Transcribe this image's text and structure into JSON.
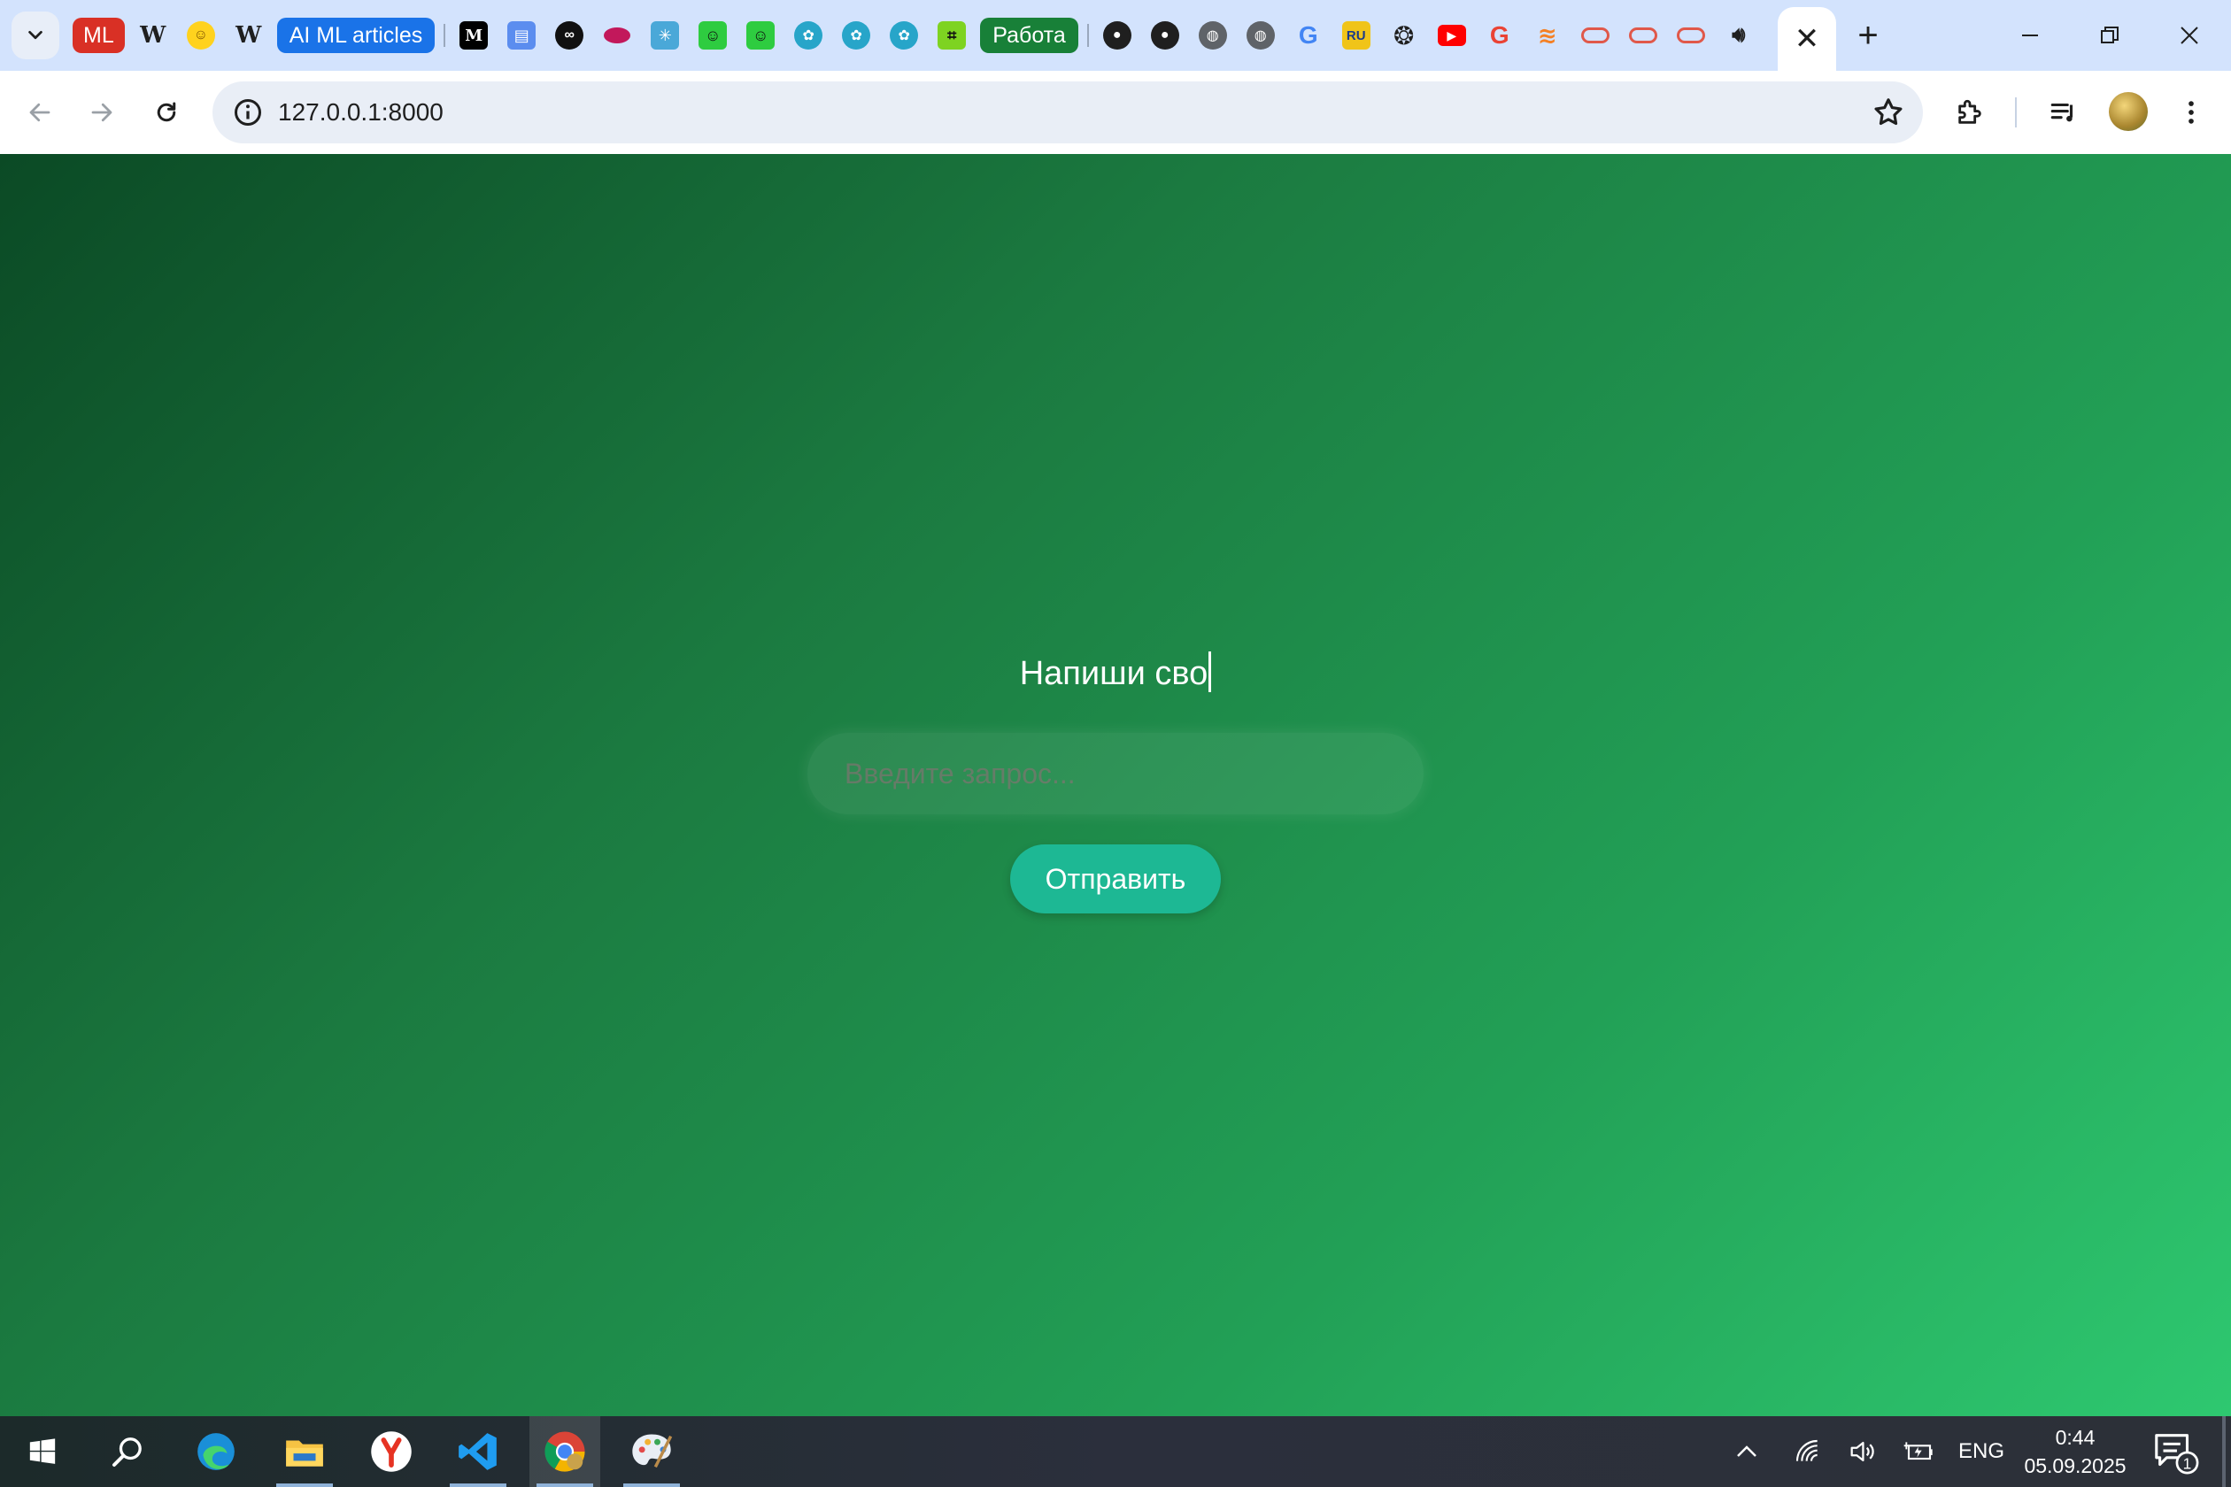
{
  "browser": {
    "tabs": {
      "ml_label": "ML",
      "ai_ml_group_label": "AI ML articles",
      "work_group_label": "Работа",
      "active_tab_close": "✕",
      "new_tab": "+",
      "colors": {
        "strip_bg": "#d3e3fd",
        "ml_chip": "#d93025",
        "ai_ml_group": "#1a73e8",
        "work_group": "#188038"
      }
    },
    "address_bar": {
      "url": "127.0.0.1:8000"
    },
    "window_controls": [
      "minimize",
      "restore",
      "close"
    ]
  },
  "page": {
    "heading_typed": "Напиши сво",
    "input": {
      "placeholder": "Введите запрос...",
      "value": ""
    },
    "submit_label": "Отправить",
    "colors": {
      "gradient_start": "#0b4a25",
      "gradient_end": "#2ec870",
      "button_bg": "#1db894"
    }
  },
  "taskbar": {
    "apps": [
      "windows-start",
      "search",
      "edge",
      "file-explorer",
      "yandex-browser",
      "vscode",
      "chrome",
      "paint"
    ],
    "tray": {
      "language": "ENG",
      "time": "0:44",
      "date": "05.09.2025",
      "notifications_count": "1"
    }
  }
}
